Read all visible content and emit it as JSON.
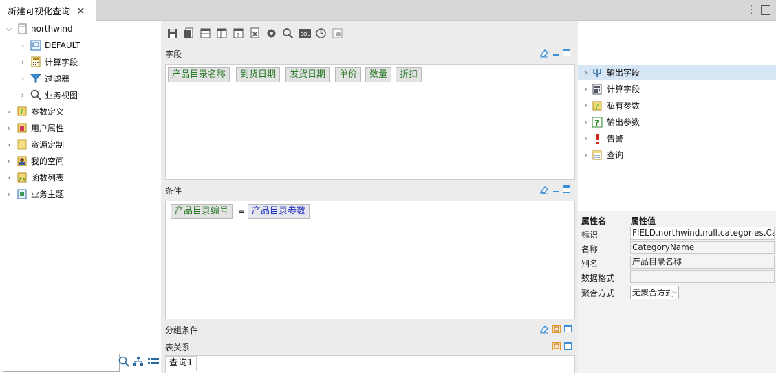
{
  "tab": {
    "title": "新建可视化查询",
    "close": "✕"
  },
  "window": {
    "menu": "⋮"
  },
  "tree": {
    "root": "northwind",
    "children": [
      "DEFAULT",
      "计算字段",
      "过滤器",
      "业务视图"
    ],
    "top": [
      "参数定义",
      "用户属性",
      "资源定制",
      "我的空间",
      "函数列表",
      "业务主题"
    ]
  },
  "search": {
    "placeholder": ""
  },
  "sections": {
    "fields": "字段",
    "conditions": "条件",
    "grouping": "分组条件",
    "relations": "表关系"
  },
  "fields": [
    "产品目录名称",
    "到货日期",
    "发货日期",
    "单价",
    "数量",
    "折扣"
  ],
  "condition": {
    "left": "产品目录编号",
    "op": "=",
    "right": "产品目录参数"
  },
  "query_tab": "查询1",
  "right_tree": [
    "输出字段",
    "计算字段",
    "私有参数",
    "输出参数",
    "告警",
    "查询"
  ],
  "props": {
    "col_name": "属性名",
    "col_value": "属性值",
    "rows": [
      {
        "k": "标识",
        "v": "FIELD.northwind.null.categories.CategoryName"
      },
      {
        "k": "名称",
        "v": "CategoryName"
      },
      {
        "k": "别名",
        "v": "产品目录名称"
      },
      {
        "k": "数据格式",
        "v": ""
      },
      {
        "k": "聚合方式",
        "v": "无聚合方式"
      }
    ]
  },
  "colors": {
    "chip_text": "#2a7a2a",
    "param_text": "#2233bb",
    "selected_row": "#d6e6f5"
  }
}
